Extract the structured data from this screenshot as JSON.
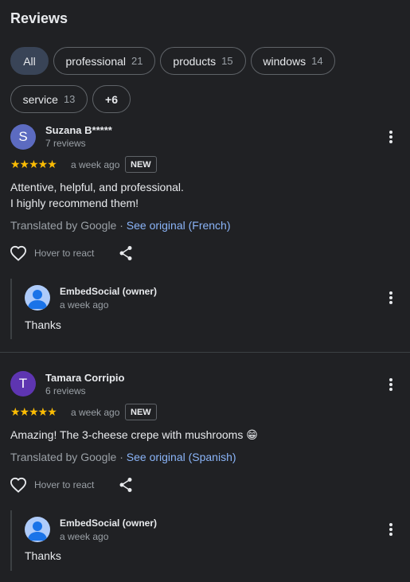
{
  "header": {
    "title": "Reviews"
  },
  "filters": [
    {
      "label": "All",
      "count": ""
    },
    {
      "label": "professional",
      "count": "21"
    },
    {
      "label": "products",
      "count": "15"
    },
    {
      "label": "windows",
      "count": "14"
    },
    {
      "label": "service",
      "count": "13"
    },
    {
      "label": "+6",
      "count": ""
    }
  ],
  "reviews": [
    {
      "initial": "S",
      "avatar_color": "#5c6bc0",
      "name": "Suzana B*****",
      "review_count": "7 reviews",
      "rating": 5,
      "stars": "★★★★★",
      "time": "a week ago",
      "badge": "NEW",
      "text": "Attentive, helpful, and professional.\nI highly recommend them!",
      "translated_by": "Translated by Google ·",
      "see_original": "See original (French)",
      "react_label": "Hover to react",
      "reply": {
        "owner": "EmbedSocial (owner)",
        "time": "a week ago",
        "text": "Thanks"
      }
    },
    {
      "initial": "T",
      "avatar_color": "#5e35b1",
      "name": "Tamara Corripio",
      "review_count": "6 reviews",
      "rating": 5,
      "stars": "★★★★★",
      "time": "a week ago",
      "badge": "NEW",
      "text": "Amazing! The 3-cheese crepe with mushrooms 😁",
      "translated_by": "Translated by Google ·",
      "see_original": "See original (Spanish)",
      "react_label": "Hover to react",
      "reply": {
        "owner": "EmbedSocial (owner)",
        "time": "a week ago",
        "text": "Thanks"
      }
    }
  ],
  "colors": {
    "background": "#202124",
    "accent_chip": "#394457",
    "link": "#8ab4f8",
    "star": "#fbbc04"
  }
}
